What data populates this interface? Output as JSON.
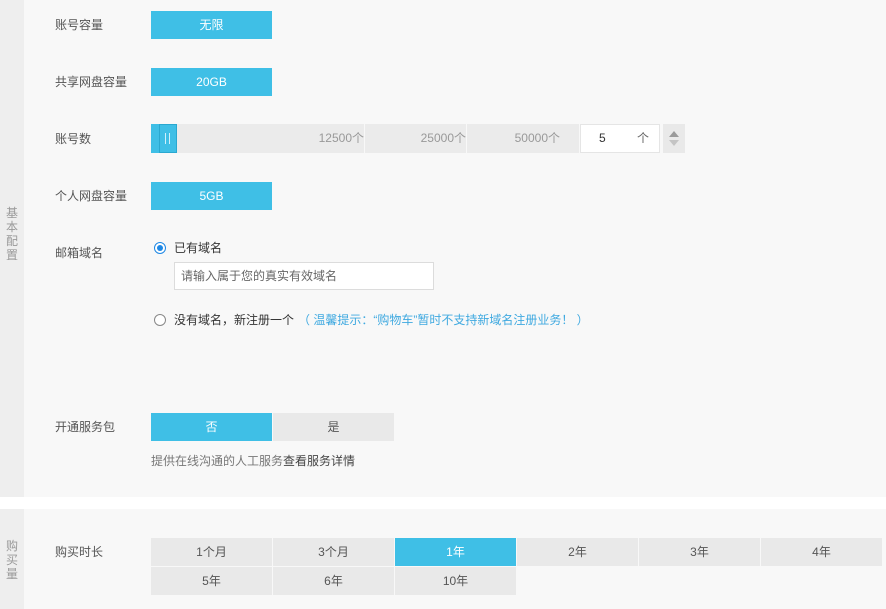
{
  "basic_config": {
    "section_label": [
      "基",
      "本",
      "配",
      "置"
    ],
    "account_capacity": {
      "label": "账号容量",
      "value": "无限"
    },
    "shared_disk": {
      "label": "共享网盘容量",
      "value": "20GB"
    },
    "account_count": {
      "label": "账号数",
      "ticks": [
        "12500个",
        "25000个",
        "50000个"
      ],
      "value": "5",
      "unit": "个",
      "slider_fraction": 0.0
    },
    "personal_disk": {
      "label": "个人网盘容量",
      "value": "5GB"
    },
    "mail_domain": {
      "label": "邮箱域名",
      "option_existing": "已有域名",
      "input_placeholder": "请输入属于您的真实有效域名",
      "option_new": "没有域名，新注册一个",
      "tip": "（ 温馨提示：“购物车”暂时不支持新域名注册业务！ ）"
    },
    "service_pack": {
      "label": "开通服务包",
      "options": [
        "否",
        "是"
      ],
      "selected": 0,
      "desc": "提供在线沟通的人工服务",
      "detail_link": "查看服务详情"
    }
  },
  "purchase": {
    "section_label": [
      "购",
      "买",
      "量"
    ],
    "duration": {
      "label": "购买时长",
      "options": [
        "1个月",
        "3个月",
        "1年",
        "2年",
        "3年",
        "4年",
        "5年",
        "6年",
        "10年"
      ],
      "selected": 2
    }
  },
  "colors": {
    "accent": "#3fbfe6",
    "tip": "#3fa9e0",
    "radio": "#1e88e5"
  }
}
